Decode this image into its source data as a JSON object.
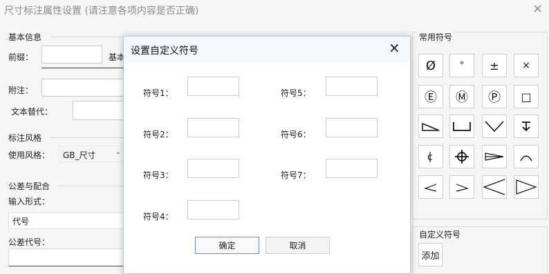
{
  "window": {
    "title": "尺寸标注属性设置 (请注意各项内容是否正确)",
    "close_symbol": "×"
  },
  "basic": {
    "group_label": "基本信息",
    "prefix_label": "前缀：",
    "basic_label_partial": "基本",
    "note_label": "附注：",
    "text_replace_label": "文本替代："
  },
  "style": {
    "group_label": "标注风格",
    "use_style_label": "使用风格：",
    "use_style_value": "GB_尺寸"
  },
  "tolerance": {
    "group_label": "公差与配合",
    "input_mode_label": "输入形式：",
    "input_mode_value": "代号",
    "code_label": "公差代号："
  },
  "symbols": {
    "group_label": "常用符号",
    "items": [
      {
        "name": "diameter-symbol",
        "glyph": "Ø"
      },
      {
        "name": "degree-symbol",
        "glyph": "°"
      },
      {
        "name": "plus-minus-symbol",
        "glyph": "±"
      },
      {
        "name": "multiply-symbol",
        "glyph": "×"
      },
      {
        "name": "circled-e-symbol",
        "glyph": "Ⓔ"
      },
      {
        "name": "circled-m-symbol",
        "glyph": "Ⓜ"
      },
      {
        "name": "circled-p-symbol",
        "glyph": "Ⓟ"
      },
      {
        "name": "square-symbol",
        "glyph": "□"
      }
    ]
  },
  "custom_symbols": {
    "group_label": "自定义符号",
    "add_label": "添加"
  },
  "dialog": {
    "title": "设置自定义符号",
    "close_symbol": "×",
    "fields": [
      {
        "label": "符号1：",
        "value": ""
      },
      {
        "label": "符号2：",
        "value": ""
      },
      {
        "label": "符号3：",
        "value": ""
      },
      {
        "label": "符号4：",
        "value": ""
      },
      {
        "label": "符号5：",
        "value": ""
      },
      {
        "label": "符号6：",
        "value": ""
      },
      {
        "label": "符号7：",
        "value": ""
      }
    ],
    "ok_label": "确定",
    "cancel_label": "取消"
  }
}
